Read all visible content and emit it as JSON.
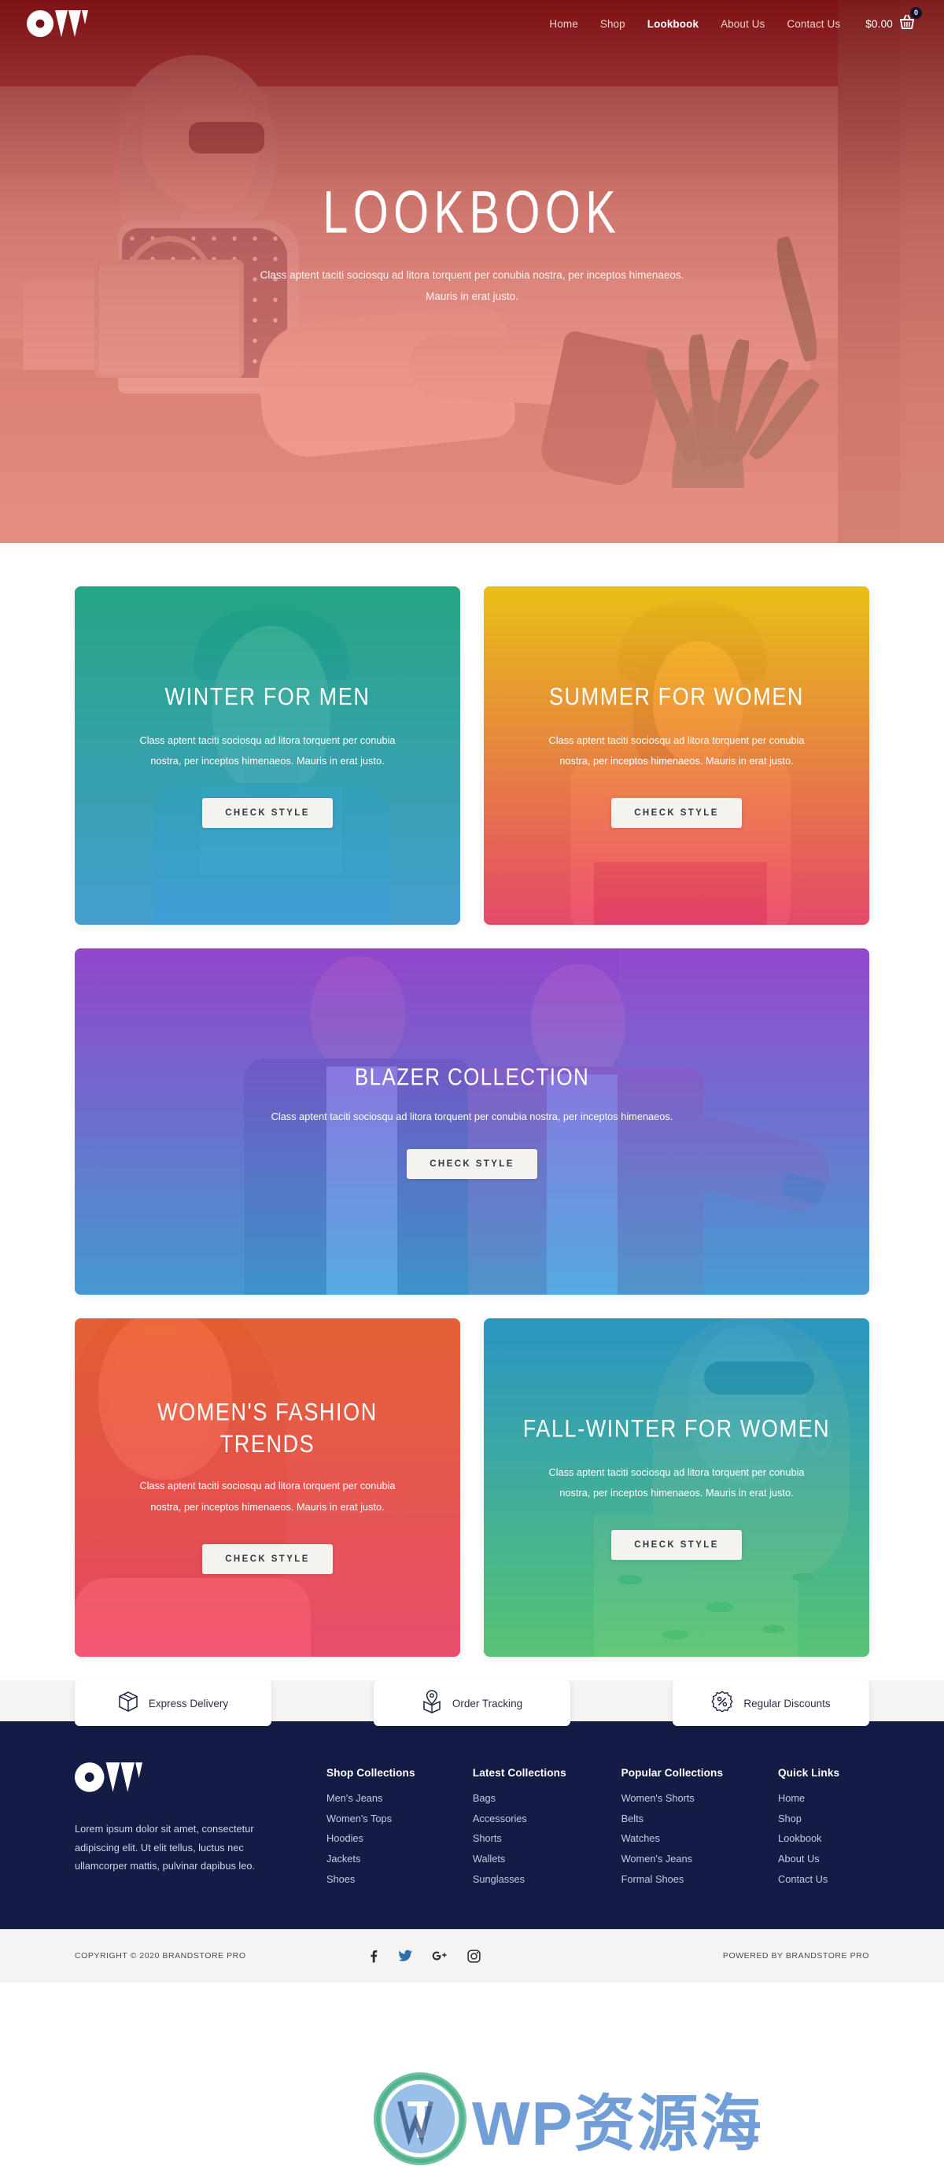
{
  "header": {
    "logo_alt": "OW brandstore logo",
    "nav": [
      {
        "label": "Home",
        "active": false
      },
      {
        "label": "Shop",
        "active": false
      },
      {
        "label": "Lookbook",
        "active": true
      },
      {
        "label": "About Us",
        "active": false
      },
      {
        "label": "Contact Us",
        "active": false
      }
    ],
    "cart": {
      "amount": "$0.00",
      "count": "0",
      "icon": "shopping-basket-icon"
    }
  },
  "hero": {
    "title": "LOOKBOOK",
    "subtitle": "Class aptent taciti sociosqu ad litora torquent per conubia nostra, per inceptos himenaeos. Mauris in erat justo."
  },
  "cards": [
    {
      "title": "WINTER FOR MEN",
      "desc": "Class aptent taciti sociosqu ad litora torquent per conubia nostra, per inceptos himenaeos. Mauris in erat justo.",
      "button": "CHECK STYLE",
      "gradient_from": "#19b08a",
      "gradient_to": "#3ea8e5"
    },
    {
      "title": "SUMMER FOR WOMEN",
      "desc": "Class aptent taciti sociosqu ad litora torquent per conubia nostra, per inceptos himenaeos. Mauris in erat justo.",
      "button": "CHECK STYLE",
      "gradient_from": "#f6c90b",
      "gradient_to": "#f43f6b"
    },
    {
      "title": "BLAZER COLLECTION",
      "desc": "Class aptent taciti sociosqu ad litora torquent per conubia nostra, per inceptos himenaeos.",
      "button": "CHECK STYLE",
      "gradient_from": "#9b3ce0",
      "gradient_to": "#3da3e0"
    },
    {
      "title": "WOMEN'S FASHION TRENDS",
      "desc": "Class aptent taciti sociosqu ad litora torquent per conubia nostra, per inceptos himenaeos. Mauris in erat justo.",
      "button": "CHECK STYLE",
      "gradient_from": "#ee5e2f",
      "gradient_to": "#f4456c"
    },
    {
      "title": "FALL-WINTER FOR WOMEN",
      "desc": "Class aptent taciti sociosqu ad litora torquent per conubia nostra, per inceptos himenaeos. Mauris in erat justo.",
      "button": "CHECK STYLE",
      "gradient_from": "#1f96cb",
      "gradient_to": "#51cf72"
    }
  ],
  "services": [
    {
      "label": "Express Delivery",
      "icon": "package-box-icon"
    },
    {
      "label": "Order Tracking",
      "icon": "tracking-pin-box-icon"
    },
    {
      "label": "Regular Discounts",
      "icon": "discount-percent-badge-icon"
    }
  ],
  "footer": {
    "about_text": "Lorem ipsum dolor sit amet, consectetur adipiscing elit. Ut elit tellus, luctus nec ullamcorper mattis, pulvinar dapibus leo.",
    "columns": [
      {
        "title": "Shop Collections",
        "links": [
          "Men's Jeans",
          "Women's Tops",
          "Hoodies",
          "Jackets",
          "Shoes"
        ]
      },
      {
        "title": "Latest Collections",
        "links": [
          "Bags",
          "Accessories",
          "Shorts",
          "Wallets",
          "Sunglasses"
        ]
      },
      {
        "title": "Popular Collections",
        "links": [
          "Women's Shorts",
          "Belts",
          "Watches",
          "Women's Jeans",
          "Formal Shoes"
        ]
      },
      {
        "title": "Quick Links",
        "links": [
          "Home",
          "Shop",
          "Lookbook",
          "About Us",
          "Contact Us"
        ]
      }
    ],
    "bottom": {
      "copyright": "COPYRIGHT © 2020 BRANDSTORE PRO",
      "powered_by": "POWERED BY BRANDSTORE PRO",
      "socials": [
        "facebook-icon",
        "twitter-icon",
        "google-plus-icon",
        "instagram-icon"
      ]
    }
  },
  "watermark": {
    "text": "WP资源海"
  },
  "colors": {
    "header_tint": "#7b1014",
    "hero_tint_bottom": "#f38a80",
    "footer_bg": "#141c46",
    "page_bg": "#f4f4f4",
    "button_bg": "#f5f3f0"
  }
}
